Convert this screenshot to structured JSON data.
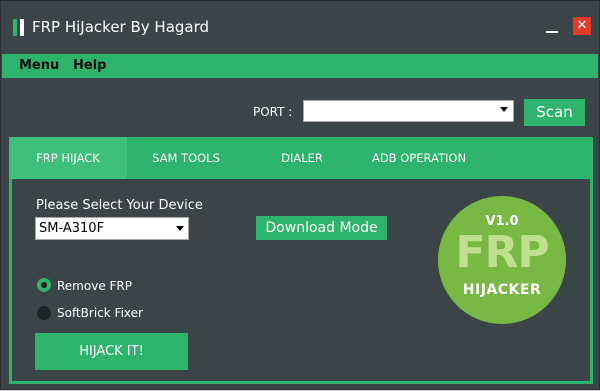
{
  "window": {
    "title": "FRP HiJacker By Hagard",
    "minimize_icon": "minimize-icon",
    "close_glyph": "✕"
  },
  "menubar": {
    "items": [
      {
        "label": "Menu"
      },
      {
        "label": "Help"
      }
    ]
  },
  "port": {
    "label": "PORT :",
    "value": "",
    "scan_label": "Scan"
  },
  "tabs": [
    {
      "label": "FRP HIJACK",
      "active": true
    },
    {
      "label": "SAM TOOLS",
      "active": false
    },
    {
      "label": "DIALER",
      "active": false
    },
    {
      "label": "ADB OPERATION",
      "active": false
    }
  ],
  "frp_panel": {
    "device_label": "Please Select Your Device",
    "device_value": "SM-A310F",
    "download_mode_label": "Download Mode",
    "options": [
      {
        "label": "Remove FRP",
        "selected": true
      },
      {
        "label": "SoftBrick Fixer",
        "selected": false
      }
    ],
    "hijack_label": "HIJACK IT!"
  },
  "logo": {
    "version": "V1.0",
    "name": "FRP",
    "subname": "HIJACKER"
  },
  "colors": {
    "accent": "#2db36b",
    "background": "#3b4446",
    "logo": "#7ab845",
    "close": "#e03a2a"
  }
}
